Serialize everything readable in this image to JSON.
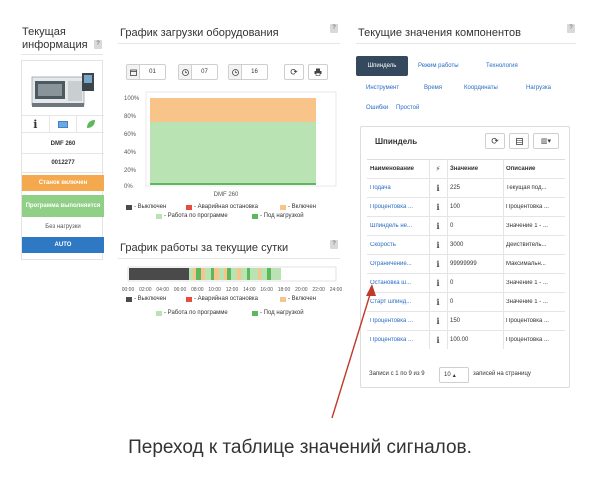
{
  "left": {
    "title": "Текущая информация",
    "help": "?",
    "model": "DMF 260",
    "serial": "0012277",
    "status_off": "Станок включен",
    "program": "Программа выполняется",
    "no_load": "Без нагрузки",
    "auto": "AUTO",
    "icons": [
      "info-icon",
      "window-icon",
      "leaf-icon"
    ]
  },
  "load_chart": {
    "title": "График загрузки оборудования",
    "help": "?",
    "toolbar": {
      "calendar_value": "01",
      "clock1_value": "07",
      "clock2_value": "16"
    },
    "machine_label": "DMF 260",
    "legend": [
      "- Выключен",
      "- Аварийная остановка",
      "- Включен",
      "- Работа по программе",
      "- Под нагрузкой"
    ]
  },
  "day_chart": {
    "title": "График работы за текущие сутки",
    "help": "?",
    "ticks": [
      "00:00",
      "02:00",
      "04:00",
      "06:00",
      "08:00",
      "10:00",
      "12:00",
      "14:00",
      "16:00",
      "18:00",
      "20:00",
      "22:00",
      "24:00"
    ],
    "legend": [
      "- Выключен",
      "- Аварийная остановка",
      "- Включен",
      "- Работа по программе",
      "- Под нагрузкой"
    ]
  },
  "components": {
    "title": "Текущие значения компонентов",
    "help": "?",
    "tabs": [
      "Шпиндель",
      "Режим работы",
      "Технология",
      "Инструмент",
      "Время",
      "Координаты",
      "Нагрузка",
      "Ошибки",
      "Простой"
    ],
    "table_title": "Шпиндель",
    "columns": [
      "Наименование",
      "⚡",
      "Значение",
      "Описание"
    ],
    "rows": [
      {
        "name": "Подача",
        "value": "225",
        "desc": "Текущая под..."
      },
      {
        "name": "Процентовка ...",
        "value": "100",
        "desc": "Процентовка ..."
      },
      {
        "name": "Шпиндель не...",
        "value": "0",
        "desc": "Значение 1 - ..."
      },
      {
        "name": "Скорость",
        "value": "3000",
        "desc": "Действитель..."
      },
      {
        "name": "Ограничение...",
        "value": "99999999",
        "desc": "Максимальн..."
      },
      {
        "name": "Остановка ш...",
        "value": "0",
        "desc": "Значение 1 - ..."
      },
      {
        "name": "Старт шпинд...",
        "value": "0",
        "desc": "Значение 1 - ..."
      },
      {
        "name": "Процентовка ...",
        "value": "150",
        "desc": "Процентовка ..."
      },
      {
        "name": "Процентовка ...",
        "value": "100.00",
        "desc": "Процентовка ..."
      }
    ],
    "footer_records": "Записи с 1 по 9 из 9",
    "page_size": "10",
    "footer_suffix": "записей на страницу"
  },
  "caption": "Переход к таблице значений сигналов.",
  "colors": {
    "off": "#4a4a4a",
    "alarm": "#e74c3c",
    "on": "#f9c48a",
    "program": "#b9e3b2",
    "load": "#5cb85c",
    "status_orange": "#f5a94e",
    "status_green": "#8fcf86",
    "auto_blue": "#2f78c4",
    "tab_active": "#34495e"
  }
}
